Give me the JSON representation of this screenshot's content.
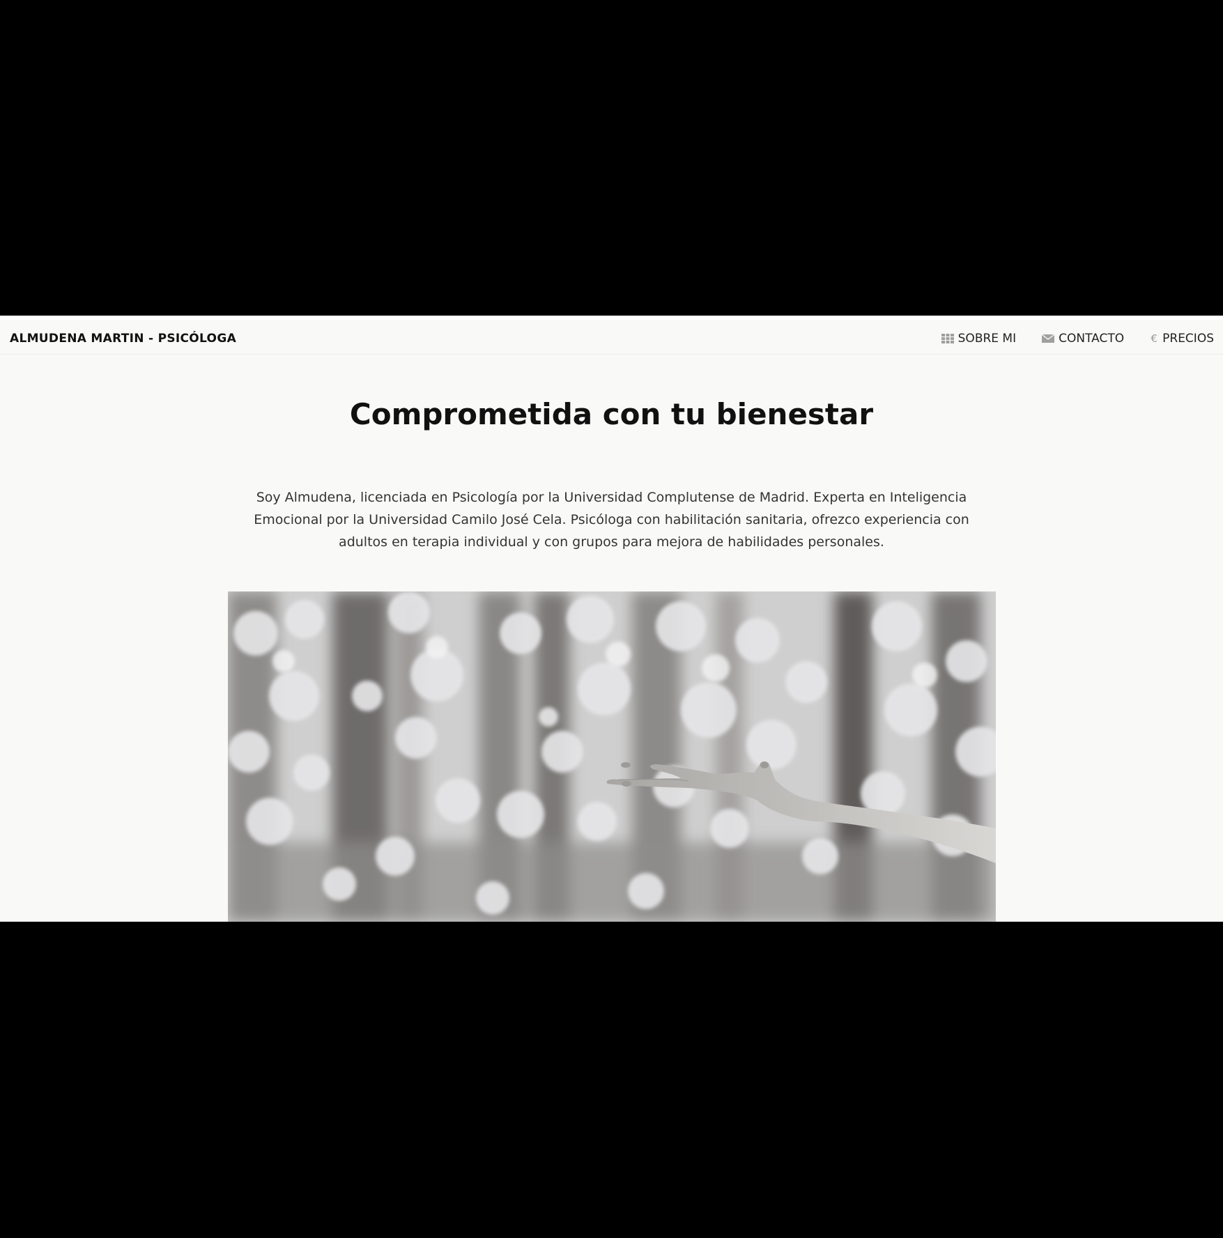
{
  "site": {
    "brand": "ALMUDENA MARTIN - PSICÓLOGA"
  },
  "nav": {
    "items": [
      {
        "label": "SOBRE MI",
        "icon": "grid-icon"
      },
      {
        "label": "CONTACTO",
        "icon": "envelope-icon"
      },
      {
        "label": "PRECIOS",
        "icon": "euro-icon"
      }
    ]
  },
  "hero": {
    "title": "Comprometida con tu bienestar",
    "intro": "Soy Almudena, licenciada en Psicología por la Universidad Complutense de Madrid. Experta en Inteligencia Emocional por la Universidad Camilo José Cela. Psicóloga con habilitación sanitaria, ofrezco experiencia con adultos en terapia individual y con grupos para mejora de habilidades personales."
  },
  "colors": {
    "page_background": "#f9f9f7",
    "text": "#111111",
    "icon_gray": "#9a9a9a"
  }
}
